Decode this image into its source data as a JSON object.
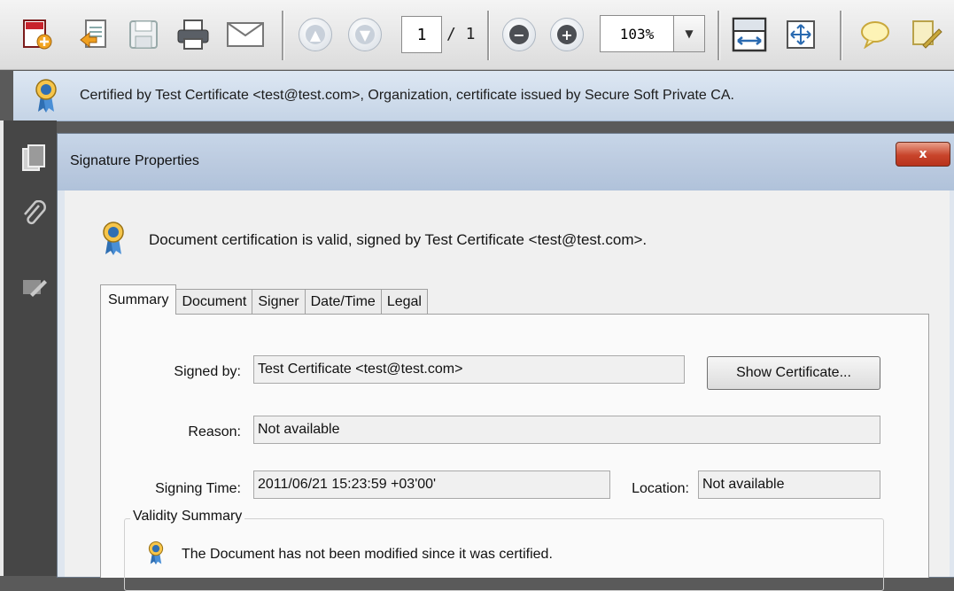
{
  "toolbar": {
    "page_current": "1",
    "page_total": "/ 1",
    "zoom": "103%",
    "icons": [
      "create-pdf-icon",
      "export-icon",
      "save-icon",
      "print-icon",
      "email-icon",
      "prev-page-icon",
      "next-page-icon",
      "zoom-out-icon",
      "zoom-in-icon",
      "fit-width-icon",
      "fit-page-icon",
      "comment-icon",
      "sign-icon"
    ]
  },
  "cert_bar": {
    "text": "Certified by Test Certificate <test@test.com>, Organization, certificate issued by Secure Soft Private CA."
  },
  "dialog": {
    "title": "Signature Properties",
    "close_label": "x",
    "validity_line": "Document certification is valid, signed by Test Certificate <test@test.com>.",
    "tabs": [
      "Summary",
      "Document",
      "Signer",
      "Date/Time",
      "Legal"
    ],
    "active_tab": "Summary",
    "fields": {
      "signed_by_label": "Signed by:",
      "signed_by_value": "Test Certificate <test@test.com>",
      "reason_label": "Reason:",
      "reason_value": "Not available",
      "signing_time_label": "Signing Time:",
      "signing_time_value": "2011/06/21 15:23:59 +03'00'",
      "location_label": "Location:",
      "location_value": "Not available"
    },
    "show_certificate_label": "Show Certificate...",
    "validity_summary": {
      "legend": "Validity Summary",
      "line1": "The Document has not been modified since it was certified."
    }
  },
  "colors": {
    "cert_bar_bg": "#c9d8ea",
    "dialog_title_bg": "#bccbe0",
    "close_button": "#c8442b",
    "ribbon_blue": "#2f6fb3"
  }
}
